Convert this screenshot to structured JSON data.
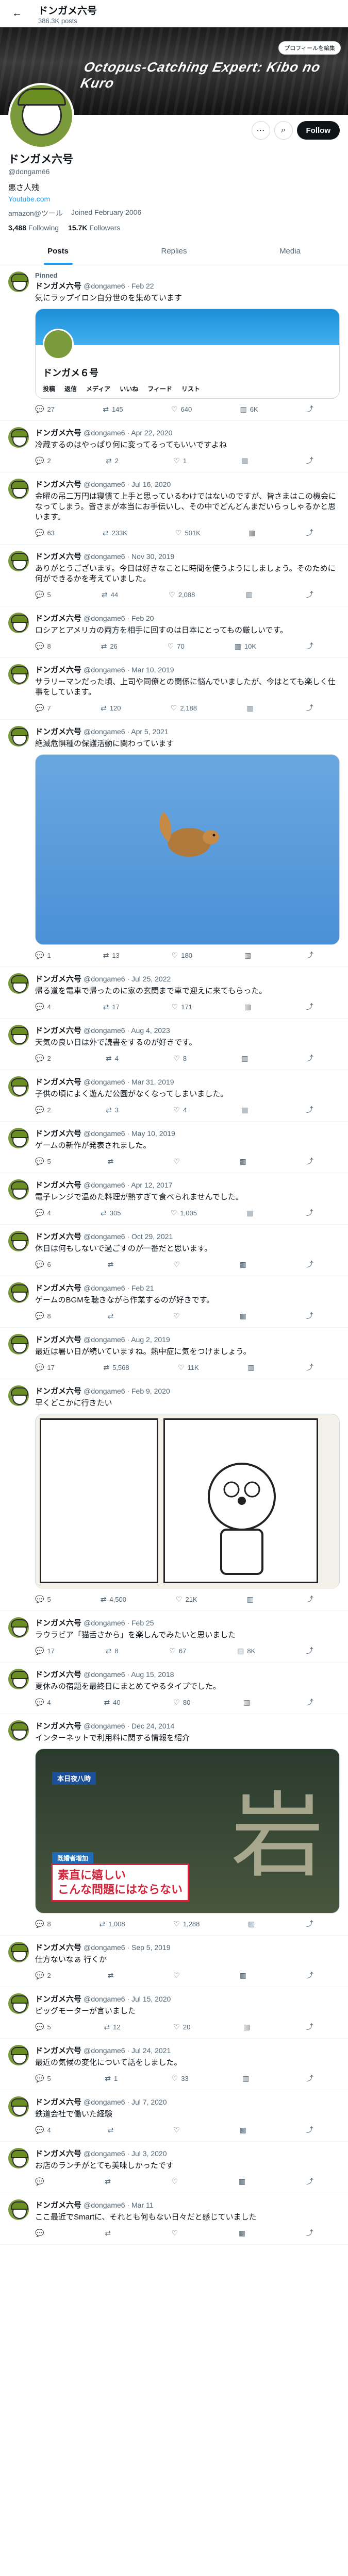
{
  "header": {
    "name": "ドンガメ六号",
    "posts": "386.3K posts"
  },
  "banner": {
    "text": "Octopus-Catching Expert: Kibo no Kuro"
  },
  "profile": {
    "name": "ドンガメ六号",
    "handle": "@dongamé6",
    "bio": "悪さ人残",
    "link": "Youtube.com",
    "location": "amazon@ツール",
    "joined": "Joined February 2006",
    "following": "3,488",
    "following_label": "Following",
    "followers": "15.7K",
    "followers_label": "Followers",
    "follow_label": "Follow"
  },
  "tabs": [
    "Posts",
    "Replies",
    "Media"
  ],
  "tweets": [
    {
      "pinned": "Pinned",
      "name": "ドンガメ六号",
      "meta": "@dongame6 · Feb 22",
      "text": "気にラップイロン自分世のを集めています",
      "replies": "27",
      "reposts": "145",
      "likes": "640",
      "views": "6K"
    },
    {
      "name": "ドンガメ六号",
      "meta": "@dongame6 · Apr 22, 2020",
      "text": "冷蔵するのはやっぱり何に変ってるってもいいですよね",
      "replies": "2",
      "reposts": "2",
      "likes": "1",
      "views": ""
    },
    {
      "name": "ドンガメ六号",
      "meta": "@dongame6 · Jul 16, 2020",
      "text": "金曜の吊二万円は寝慣て上手と思っているわけではないのですが、皆さまはこの機会になってしまう。皆さまが本当にお手伝いし、その中でどんどんまだいらっしゃるかと思います。",
      "replies": "63",
      "reposts": "233K",
      "likes": "501K",
      "views": ""
    },
    {
      "name": "ドンガメ六号",
      "meta": "@dongame6 · Nov 30, 2019",
      "text": "ありがとうございます。今日は好きなことに時間を使うようにしましょう。そのために何ができるかを考えていました。",
      "replies": "5",
      "reposts": "44",
      "likes": "2,088",
      "views": ""
    },
    {
      "name": "ドンガメ六号",
      "meta": "@dongame6 · Feb 20",
      "text": "ロシアとアメリカの両方を相手に回すのは日本にとってもの厳しいです。",
      "replies": "8",
      "reposts": "26",
      "likes": "70",
      "views": "10K"
    },
    {
      "name": "ドンガメ六号",
      "meta": "@dongame6 · Mar 10, 2019",
      "text": "サラリーマンだった頃、上司や同僚との関係に悩んでいましたが、今はとても楽しく仕事をしています。",
      "replies": "7",
      "reposts": "120",
      "likes": "2,188",
      "views": ""
    },
    {
      "name": "ドンガメ六号",
      "meta": "@dongame6 · Apr 5, 2021",
      "text": "絶滅危惧種の保護活動に関わっています",
      "replies": "1",
      "reposts": "13",
      "likes": "180",
      "views": ""
    },
    {
      "name": "ドンガメ六号",
      "meta": "@dongame6 · Jul 25, 2022",
      "text": "帰る道を電車で帰ったのに家の玄関まで車で迎えに来てもらった。",
      "replies": "4",
      "reposts": "17",
      "likes": "171",
      "views": ""
    },
    {
      "name": "ドンガメ六号",
      "meta": "@dongame6 · Aug 4, 2023",
      "text": "天気の良い日は外で読書をするのが好きです。",
      "replies": "2",
      "reposts": "4",
      "likes": "8",
      "views": ""
    },
    {
      "name": "ドンガメ六号",
      "meta": "@dongame6 · Mar 31, 2019",
      "text": "子供の頃によく遊んだ公園がなくなってしまいました。",
      "replies": "2",
      "reposts": "3",
      "likes": "4",
      "views": ""
    },
    {
      "name": "ドンガメ六号",
      "meta": "@dongame6 · May 10, 2019",
      "text": "ゲームの新作が発表されました。",
      "replies": "5",
      "reposts": "",
      "likes": "",
      "views": ""
    },
    {
      "name": "ドンガメ六号",
      "meta": "@dongame6 · Apr 12, 2017",
      "text": "電子レンジで温めた料理が熱すぎて食べられませんでした。",
      "replies": "4",
      "reposts": "305",
      "likes": "1,005",
      "views": ""
    },
    {
      "name": "ドンガメ六号",
      "meta": "@dongame6 · Oct 29, 2021",
      "text": "休日は何もしないで過ごすのが一番だと思います。",
      "replies": "6",
      "reposts": "",
      "likes": "",
      "views": ""
    },
    {
      "name": "ドンガメ六号",
      "meta": "@dongame6 · Feb 21",
      "text": "ゲームのBGMを聴きながら作業するのが好きです。",
      "replies": "8",
      "reposts": "",
      "likes": "",
      "views": ""
    },
    {
      "name": "ドンガメ六号",
      "meta": "@dongame6 · Aug 2, 2019",
      "text": "最近は暑い日が続いていますね。熱中症に気をつけましょう。",
      "replies": "17",
      "reposts": "5,568",
      "likes": "11K",
      "views": ""
    },
    {
      "name": "ドンガメ六号",
      "meta": "@dongame6 · Feb 9, 2020",
      "text": "早くどこかに行きたい",
      "replies": "5",
      "reposts": "4,500",
      "likes": "21K",
      "views": ""
    },
    {
      "name": "ドンガメ六号",
      "meta": "@dongame6 · Feb 25",
      "text": "ラウラビア「猫舌さから」を楽しんでみたいと思いました",
      "replies": "17",
      "reposts": "8",
      "likes": "67",
      "views": "8K"
    },
    {
      "name": "ドンガメ六号",
      "meta": "@dongame6 · Aug 15, 2018",
      "text": "夏休みの宿題を最終日にまとめてやるタイプでした。",
      "replies": "4",
      "reposts": "40",
      "likes": "80",
      "views": ""
    },
    {
      "name": "ドンガメ六号",
      "meta": "@dongame6 · Dec 24, 2014",
      "text": "インターネットで利用料に関する情報を紹介",
      "replies": "8",
      "reposts": "1,008",
      "likes": "1,288",
      "views": ""
    },
    {
      "name": "ドンガメ六号",
      "meta": "@dongame6 · Sep 5, 2019",
      "text": "仕方ないなぁ 行くか",
      "replies": "2",
      "reposts": "",
      "likes": "",
      "views": ""
    },
    {
      "name": "ドンガメ六号",
      "meta": "@dongame6 · Jul 15, 2020",
      "text": "ピッグモーターが言いました",
      "replies": "5",
      "reposts": "12",
      "likes": "20",
      "views": ""
    },
    {
      "name": "ドンガメ六号",
      "meta": "@dongame6 · Jul 24, 2021",
      "text": "最近の気候の変化について話をしました。",
      "replies": "5",
      "reposts": "1",
      "likes": "33",
      "views": ""
    },
    {
      "name": "ドンガメ六号",
      "meta": "@dongame6 · Jul 7, 2020",
      "text": "鉄道会社で働いた経験",
      "replies": "4",
      "reposts": "",
      "likes": "",
      "views": ""
    },
    {
      "name": "ドンガメ六号",
      "meta": "@dongame6 · Jul 3, 2020",
      "text": "お店のランチがとても美味しかったです",
      "replies": "",
      "reposts": "",
      "likes": "",
      "views": ""
    },
    {
      "name": "ドンガメ六号",
      "meta": "@dongame6 · Mar 11",
      "text": "ここ最近でSmartに、それとも何もない日々だと感じていました",
      "replies": "",
      "reposts": "",
      "likes": "",
      "views": ""
    }
  ],
  "media": {
    "quote_name": "ドンガメ６号",
    "quote_tabs": [
      "投稿",
      "返信",
      "メディア",
      "いいね",
      "フィード",
      "リスト"
    ],
    "quote_btn": "プロフィールを編集",
    "tv_cap1": "本日夜八時",
    "tv_cap2": "既婚者増加",
    "tv_box": "素直に嬉しい\nこんな問題にはならない"
  }
}
